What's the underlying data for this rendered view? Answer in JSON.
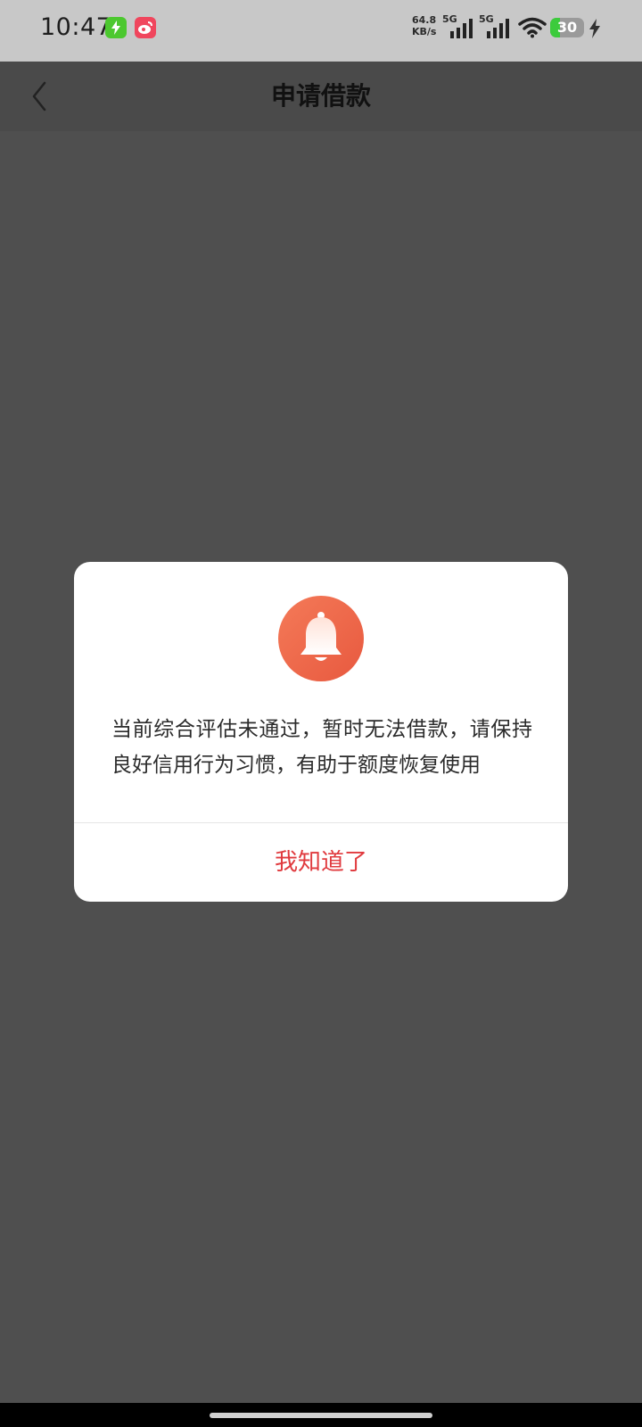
{
  "status_bar": {
    "time": "10:47",
    "net_speed_value": "64.8",
    "net_speed_unit": "KB/s",
    "sim1_label": "5G",
    "sim2_label": "5G",
    "battery_level": "30",
    "battery_fraction": 0.3,
    "icons": [
      "charging-app-icon",
      "weibo-icon",
      "signal-icon",
      "signal-icon",
      "wifi-icon",
      "battery-icon",
      "charging-bolt-icon"
    ],
    "colors": {
      "battery": "#3ccb3c",
      "app1": "#4cc82f",
      "app2": "#f0465d"
    }
  },
  "header": {
    "title": "申请借款",
    "back_icon": "chevron-left-icon"
  },
  "dialog": {
    "icon": "bell-icon",
    "icon_color": "#ee6a4c",
    "message": "当前综合评估未通过，暂时无法借款，请保持良好信用行为习惯，有助于额度恢复使用",
    "confirm_label": "我知道了",
    "confirm_color": "#e03a3e"
  }
}
